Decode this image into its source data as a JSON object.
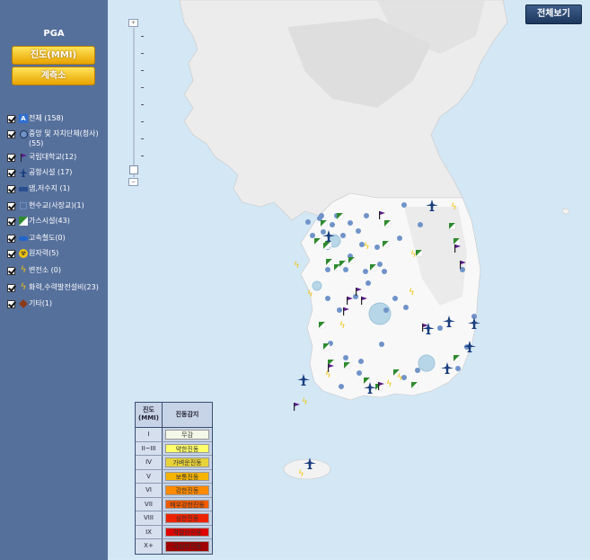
{
  "sidebar": {
    "title": "PGA",
    "mmi_button": "진도(MMI)",
    "station_button": "계측소",
    "layers": [
      {
        "label": "전체 (158)",
        "icon": "all-icon",
        "color": "#2e6fd1"
      },
      {
        "label": "중앙 및 자치단체(청사) (55)",
        "icon": "government-circle-icon",
        "color": "#6f93c9"
      },
      {
        "label": "국립대학교(12)",
        "icon": "university-flag-icon",
        "color": "#5a1a8a"
      },
      {
        "label": "공항시설 (17)",
        "icon": "airport-plane-icon",
        "color": "#1a3f80"
      },
      {
        "label": "댐,저수지 (1)",
        "icon": "dam-icon",
        "color": "#2a4f8f"
      },
      {
        "label": "현수교(사장교)(1)",
        "icon": "bridge-icon",
        "color": "#6a8fc0"
      },
      {
        "label": "가스시설(43)",
        "icon": "gas-facility-icon",
        "color": "#2e8b2e"
      },
      {
        "label": "고속철도(0)",
        "icon": "rail-icon",
        "color": "#2266cc"
      },
      {
        "label": "원자력(5)",
        "icon": "nuclear-icon",
        "color": "#f1c40f"
      },
      {
        "label": "변전소 (0)",
        "icon": "substation-bolt-icon",
        "color": "#f1c40f"
      },
      {
        "label": "화력,수력발전설비(23)",
        "icon": "power-plant-bolt-icon",
        "color": "#f1c40f"
      },
      {
        "label": "기타(1)",
        "icon": "other-diamond-icon",
        "color": "#8b3a1a"
      }
    ]
  },
  "map": {
    "full_view_button": "전체보기",
    "land_color": "#f6f6f6",
    "sea_color": "#d3e7f5"
  },
  "legend": {
    "col_level": "진도\n(MMI)",
    "col_desc": "진동감지",
    "rows": [
      {
        "level": "I",
        "label": "무감",
        "color": "#f4f8e8"
      },
      {
        "level": "II~III",
        "label": "약한진동",
        "color": "#ffff6a"
      },
      {
        "level": "IV",
        "label": "가벼운진동",
        "color": "#e8d23a"
      },
      {
        "level": "V",
        "label": "보통진동",
        "color": "#f5b400"
      },
      {
        "level": "VI",
        "label": "강한진동",
        "color": "#ff8a00"
      },
      {
        "level": "VII",
        "label": "매우강한진동",
        "color": "#f25a00"
      },
      {
        "level": "VIII",
        "label": "심한진동",
        "color": "#ee2200"
      },
      {
        "level": "IX",
        "label": "격렬한진동",
        "color": "#dd0000"
      },
      {
        "level": "X+",
        "label": "극심한진동",
        "color": "#a00000"
      }
    ]
  }
}
